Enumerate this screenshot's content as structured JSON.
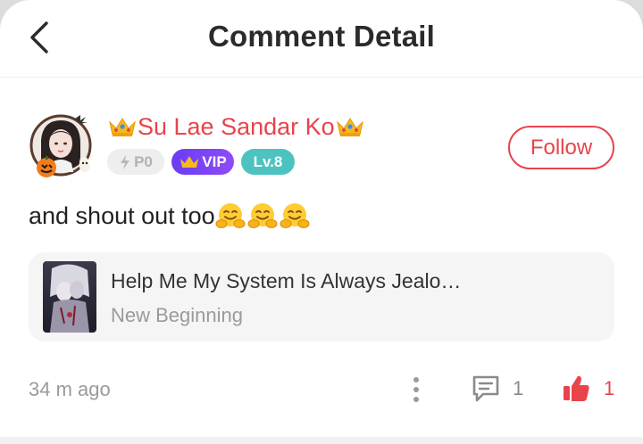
{
  "header": {
    "title": "Comment Detail"
  },
  "user": {
    "name": "Su Lae Sandar Ko",
    "badges": {
      "power": "P0",
      "vip": "VIP",
      "level": "Lv.8"
    },
    "follow_label": "Follow"
  },
  "comment": {
    "text": "and shout out too"
  },
  "book": {
    "title": "Help Me My System Is Always Jealo…",
    "chapter": "New Beginning"
  },
  "footer": {
    "timestamp": "34 m ago",
    "reply_count": "1",
    "like_count": "1"
  },
  "colors": {
    "accent": "#e9434b",
    "vip": "#7a45f6",
    "level": "#4cc3c1",
    "muted": "#9a9a9a"
  },
  "icons": [
    "back-arrow-icon",
    "crown-icon",
    "lightning-icon",
    "hugging-face-emoji",
    "more-vertical-icon",
    "comment-icon",
    "thumbs-up-icon"
  ]
}
